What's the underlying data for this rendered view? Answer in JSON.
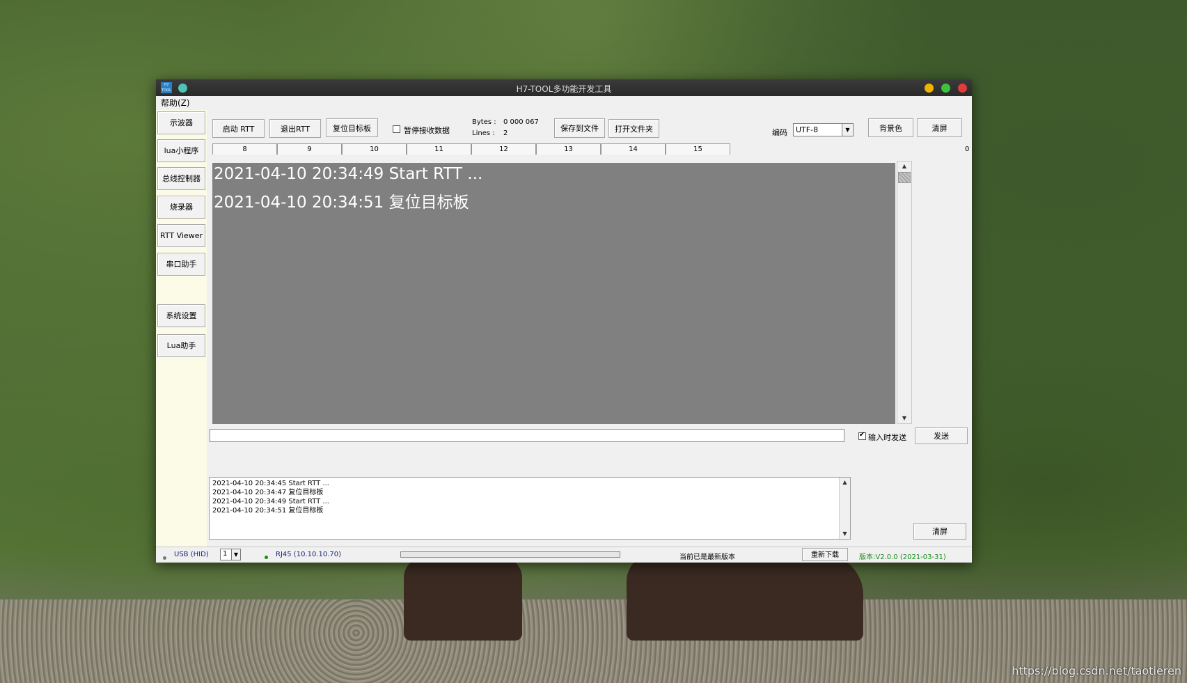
{
  "window": {
    "title": "H7-TOOL多功能开发工具",
    "app_icon_text": "H7 TOOL",
    "menu": [
      "帮助(Z)"
    ]
  },
  "sidebar": {
    "items": [
      "示波器",
      "lua小程序",
      "总线控制器",
      "烧录器",
      "RTT Viewer",
      "串口助手",
      "系统设置",
      "Lua助手"
    ]
  },
  "toolbar": {
    "start_rtt": "启动 RTT",
    "exit_rtt": "退出RTT",
    "reset_target": "复位目标板",
    "pause_receive": "暂停接收数据",
    "pause_checked": false,
    "bytes_label": "Bytes :",
    "bytes_value": "0 000 067",
    "lines_label": "Lines :",
    "lines_value": "2",
    "save_to_file": "保存到文件",
    "open_folder": "打开文件夹",
    "encoding_label": "编码",
    "encoding_value": "UTF-8",
    "bg_color": "背景色",
    "clear_screen": "清屏",
    "counter_right": "0"
  },
  "tabs": [
    "8",
    "9",
    "10",
    "11",
    "12",
    "13",
    "14",
    "15"
  ],
  "display": {
    "lines": [
      "2021-04-10 20:34:49 Start RTT ...",
      "2021-04-10 20:34:51 复位目标板"
    ],
    "background": "#808080",
    "text_color": "#ffffff"
  },
  "send": {
    "input_value": "",
    "send_on_input_label": "输入时发送",
    "send_on_input_checked": true,
    "send_button": "发送"
  },
  "log": {
    "lines": [
      "2021-04-10 20:34:45 Start RTT ...",
      "2021-04-10 20:34:47 复位目标板",
      "2021-04-10 20:34:49 Start RTT ...",
      "2021-04-10 20:34:51 复位目标板"
    ],
    "clear_button": "清屏"
  },
  "status": {
    "usb": "USB (HID)",
    "port_value": "1",
    "rj45": "RJ45 (10.10.10.70)",
    "update_text": "当前已是最新版本",
    "redownload": "重新下载",
    "version": "版本:V2.0.0 (2021-03-31)",
    "version_color": "#1a8c1a",
    "link_color": "#1a237e"
  },
  "watermark": "https://blog.csdn.net/taotieren"
}
